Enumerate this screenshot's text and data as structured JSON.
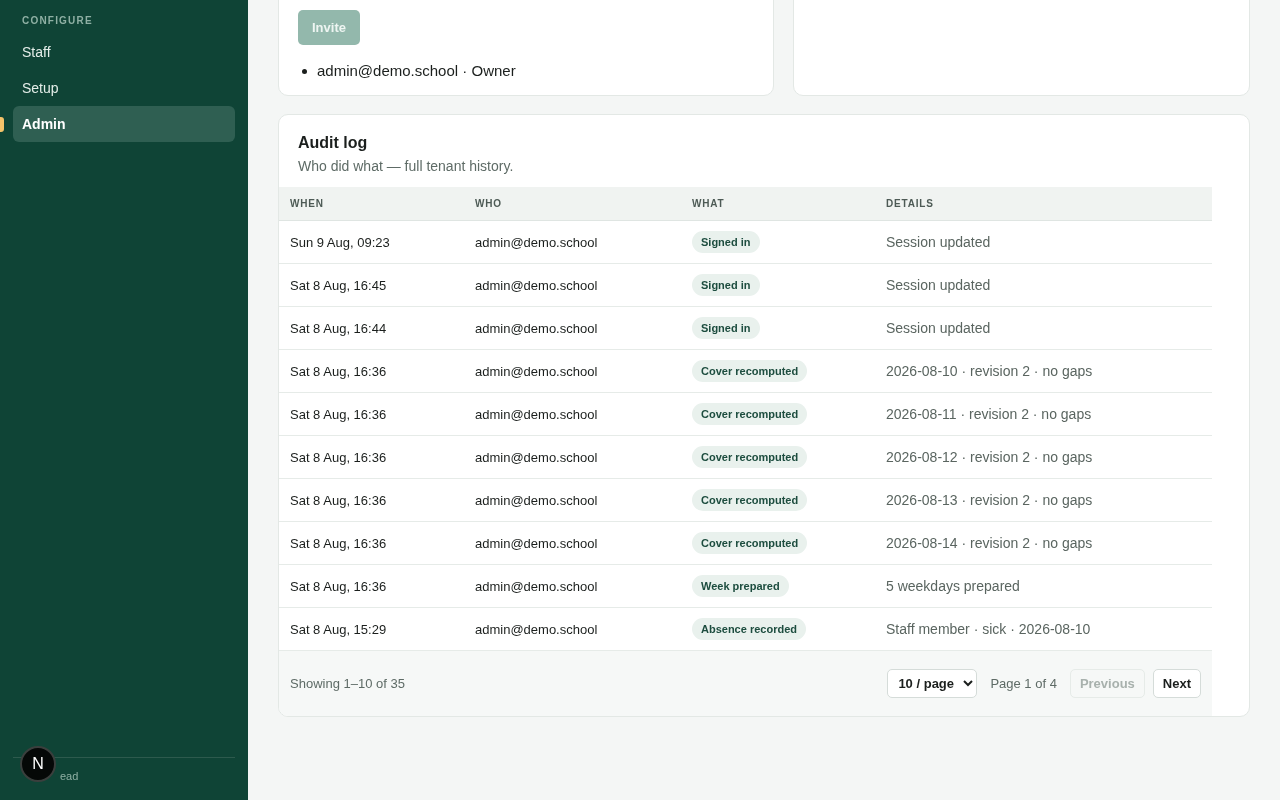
{
  "sidebar": {
    "section_label": "CONFIGURE",
    "items": [
      {
        "label": "Staff",
        "selected": false
      },
      {
        "label": "Setup",
        "selected": false
      },
      {
        "label": "Admin",
        "selected": true
      }
    ],
    "footer_text": "ead",
    "avatar": {
      "initial": "N"
    }
  },
  "members_card": {
    "invite_button": {
      "label": "Invite",
      "disabled": true
    },
    "members": [
      "admin@demo.school · Owner"
    ]
  },
  "audit_log": {
    "title": "Audit log",
    "subtitle": "Who did what — full tenant history.",
    "columns": [
      "WHEN",
      "WHO",
      "WHAT",
      "DETAILS"
    ],
    "rows": [
      {
        "when": "Sun 9 Aug, 09:23",
        "who": "admin@demo.school",
        "what": "Signed in",
        "details": "Session updated"
      },
      {
        "when": "Sat 8 Aug, 16:45",
        "who": "admin@demo.school",
        "what": "Signed in",
        "details": "Session updated"
      },
      {
        "when": "Sat 8 Aug, 16:44",
        "who": "admin@demo.school",
        "what": "Signed in",
        "details": "Session updated"
      },
      {
        "when": "Sat 8 Aug, 16:36",
        "who": "admin@demo.school",
        "what": "Cover recomputed",
        "details": "2026-08-10 · revision 2 · no gaps"
      },
      {
        "when": "Sat 8 Aug, 16:36",
        "who": "admin@demo.school",
        "what": "Cover recomputed",
        "details": "2026-08-11 · revision 2 · no gaps"
      },
      {
        "when": "Sat 8 Aug, 16:36",
        "who": "admin@demo.school",
        "what": "Cover recomputed",
        "details": "2026-08-12 · revision 2 · no gaps"
      },
      {
        "when": "Sat 8 Aug, 16:36",
        "who": "admin@demo.school",
        "what": "Cover recomputed",
        "details": "2026-08-13 · revision 2 · no gaps"
      },
      {
        "when": "Sat 8 Aug, 16:36",
        "who": "admin@demo.school",
        "what": "Cover recomputed",
        "details": "2026-08-14 · revision 2 · no gaps"
      },
      {
        "when": "Sat 8 Aug, 16:36",
        "who": "admin@demo.school",
        "what": "Week prepared",
        "details": "5 weekdays prepared"
      },
      {
        "when": "Sat 8 Aug, 15:29",
        "who": "admin@demo.school",
        "what": "Absence recorded",
        "details": "Staff member · sick · 2026-08-10"
      }
    ],
    "footer": {
      "summary": "Showing 1–10 of 35",
      "page_size": "10 / page",
      "page_info": "Page 1 of 4",
      "previous": {
        "label": "Previous",
        "disabled": true
      },
      "next": {
        "label": "Next",
        "disabled": false
      }
    }
  }
}
